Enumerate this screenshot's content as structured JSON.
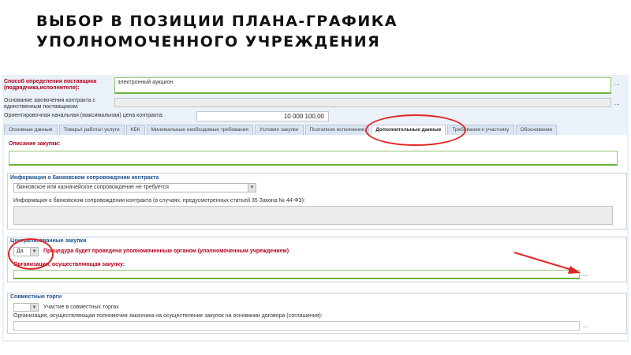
{
  "slide": {
    "title_line1": "ВЫБОР В  ПОЗИЦИИ ПЛАНА-ГРАФИКА",
    "title_line2": "УПОЛНОМОЧЕННОГО УЧРЕЖДЕНИЯ"
  },
  "form": {
    "supplier_method": {
      "label": "Способ определения поставщика (подрядчика,исполнителя):",
      "value": "электронный аукцион"
    },
    "single_supplier_basis": {
      "label": "Основание заключения контракта с единственным поставщиком:",
      "value": ""
    },
    "max_price": {
      "label": "Ориентировочная начальная (максимальная) цена контракта:",
      "value": "10 000 100,00"
    },
    "ellipsis": "..."
  },
  "tabs": [
    {
      "label": "Основные данные"
    },
    {
      "label": "Товары\\ работы\\ услуги"
    },
    {
      "label": "КБК"
    },
    {
      "label": "Минимальные необходимые требования"
    },
    {
      "label": "Условия закупки"
    },
    {
      "label": "Поэтапное исполнение"
    },
    {
      "label": "Дополнительные данные"
    },
    {
      "label": "Требования к участнику"
    },
    {
      "label": "Обоснование"
    }
  ],
  "purchase_description": {
    "label": "Описание закупки:",
    "value": ""
  },
  "bank_support": {
    "section_title": "Информация о банковском сопровождении контракта",
    "selected": "банковское или казначейское сопровождение не требуется",
    "info_label": "Информация о банковском сопровождении контракта (в случаях, предусмотренных статьей 35 Закона № 44-ФЗ):"
  },
  "centralized": {
    "section_title": "Централизованные закупки",
    "selected": "Да",
    "procedure_label": "Процедура будет проведена уполномоченным органом (уполномоченным учреждением)",
    "org_label": "Организация, осуществляющая закупку:",
    "org_value": ""
  },
  "joint": {
    "section_title": "Совместные торги",
    "selected": "",
    "participation_label": "Участие в совместных торгах",
    "org_label": "Организация, осуществляющая полномочия заказчика на осуществление закупок на основании договора (соглашения):",
    "org_value": ""
  },
  "colors": {
    "highlight": "#e02626",
    "label_red": "#b0001a",
    "label_blue": "#1c4f8e",
    "field_border_green": "#6cb43c"
  },
  "icons": {
    "dropdown": "chevron-down-icon",
    "annotation_arrow": "arrow-icon"
  }
}
